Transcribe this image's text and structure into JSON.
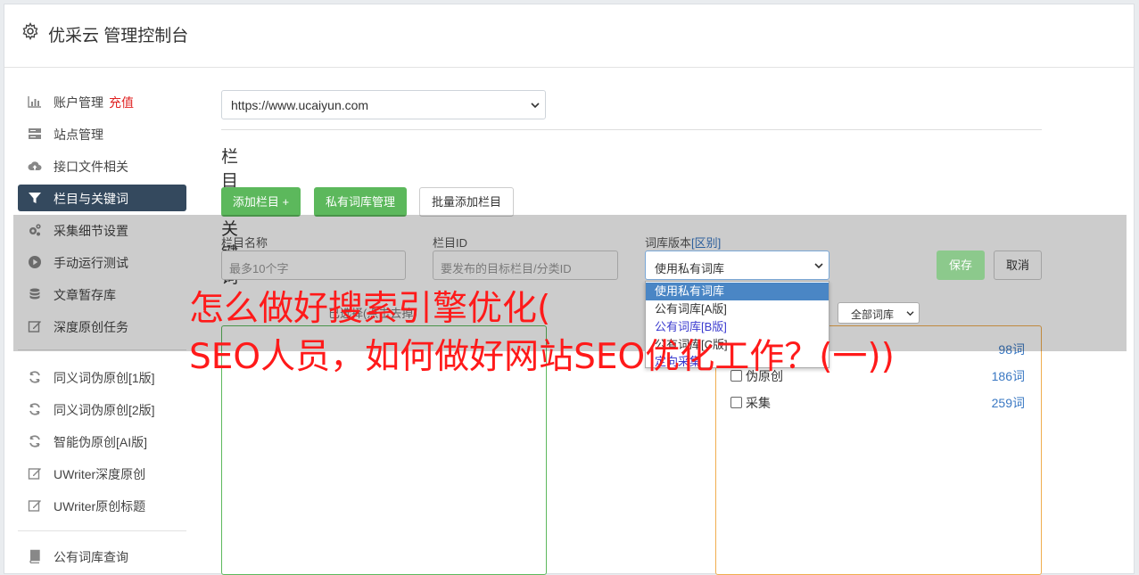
{
  "header": {
    "title": "优采云 管理控制台",
    "icon": "gear-icon"
  },
  "sidebar": {
    "items": [
      {
        "label": "账户管理",
        "badge": "充值",
        "icon": "bar-chart-icon"
      },
      {
        "label": "站点管理",
        "icon": "server-icon"
      },
      {
        "label": "接口文件相关",
        "icon": "cloud-upload-icon"
      },
      {
        "label": "栏目与关键词",
        "icon": "filter-icon",
        "active": true
      },
      {
        "label": "采集细节设置",
        "icon": "cogs-icon"
      },
      {
        "label": "手动运行测试",
        "icon": "play-circle-icon"
      },
      {
        "label": "文章暂存库",
        "icon": "database-icon"
      },
      {
        "label": "深度原创任务",
        "icon": "edit-icon"
      },
      {
        "label": "同义词伪原创[1版]",
        "icon": "refresh-icon"
      },
      {
        "label": "同义词伪原创[2版]",
        "icon": "refresh-icon"
      },
      {
        "label": "智能伪原创[AI版]",
        "icon": "refresh-icon"
      },
      {
        "label": "UWriter深度原创",
        "icon": "edit-icon"
      },
      {
        "label": "UWriter原创标题",
        "icon": "edit-icon"
      },
      {
        "label": "公有词库查询",
        "icon": "book-icon"
      }
    ]
  },
  "main": {
    "site_select": "https://www.ucaiyun.com",
    "section_title": "栏目与关键词",
    "buttons": {
      "add_column": "添加栏目 +",
      "private_lib": "私有词库管理",
      "batch_add": "批量添加栏目"
    },
    "form": {
      "name_label": "栏目名称",
      "name_placeholder": "最多10个字",
      "id_label": "栏目ID",
      "id_placeholder": "要发布的目标栏目/分类ID",
      "version_label": "词库版本",
      "version_link": "[区别]",
      "version_value": "使用私有词库",
      "save": "保存",
      "cancel": "取消"
    },
    "version_options": [
      "使用私有词库",
      "公有词库[A版]",
      "公有词库[B版]",
      "公有词库[C版]",
      "定向采集"
    ],
    "selected_label": "已选择(点击去掉)",
    "filter_select": "全部词库",
    "libraries": [
      {
        "name": "",
        "count": "98词"
      },
      {
        "name": "伪原创",
        "count": "186词"
      },
      {
        "name": "采集",
        "count": "259词"
      }
    ]
  },
  "overlay": {
    "line1": "怎么做好搜索引擎优化(",
    "line2": "SEO人员，如何做好网站SEO优化工作？(一))"
  },
  "colors": {
    "accent_green": "#5cb85c",
    "active_nav": "#34495e",
    "overlay_red": "#ff1a1a",
    "link_blue": "#3a78c3"
  }
}
